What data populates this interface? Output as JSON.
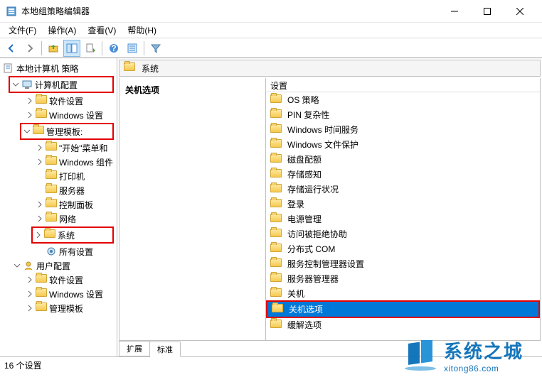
{
  "window": {
    "title": "本地组策略编辑器"
  },
  "menus": {
    "file": "文件(F)",
    "action": "操作(A)",
    "view": "查看(V)",
    "help": "帮助(H)"
  },
  "tree": {
    "root": "本地计算机 策略",
    "computer_config": "计算机配置",
    "software_settings": "软件设置",
    "windows_settings": "Windows 设置",
    "admin_templates": "管理模板:",
    "start_menu": "\"开始\"菜单和",
    "windows_components": "Windows 组件",
    "printers": "打印机",
    "servers": "服务器",
    "control_panel": "控制面板",
    "network": "网络",
    "system": "系统",
    "all_settings": "所有设置",
    "user_config": "用户配置",
    "user_software": "软件设置",
    "user_windows": "Windows 设置",
    "user_admin": "管理模板"
  },
  "crumb": {
    "label": "系统"
  },
  "description": {
    "title": "关机选项"
  },
  "columns": {
    "settings": "设置"
  },
  "items": [
    {
      "label": "OS 策略"
    },
    {
      "label": "PIN 复杂性"
    },
    {
      "label": "Windows 时间服务"
    },
    {
      "label": "Windows 文件保护"
    },
    {
      "label": "磁盘配额"
    },
    {
      "label": "存储感知"
    },
    {
      "label": "存储运行状况"
    },
    {
      "label": "登录"
    },
    {
      "label": "电源管理"
    },
    {
      "label": "访问被拒绝协助"
    },
    {
      "label": "分布式 COM"
    },
    {
      "label": "服务控制管理器设置"
    },
    {
      "label": "服务器管理器"
    },
    {
      "label": "关机"
    },
    {
      "label": "关机选项",
      "selected": true
    },
    {
      "label": "缓解选项"
    }
  ],
  "tabs": {
    "extended": "扩展",
    "standard": "标准"
  },
  "status": {
    "count": "16 个设置"
  },
  "watermark": {
    "cn": "系统之城",
    "en": "xitong86.com"
  }
}
